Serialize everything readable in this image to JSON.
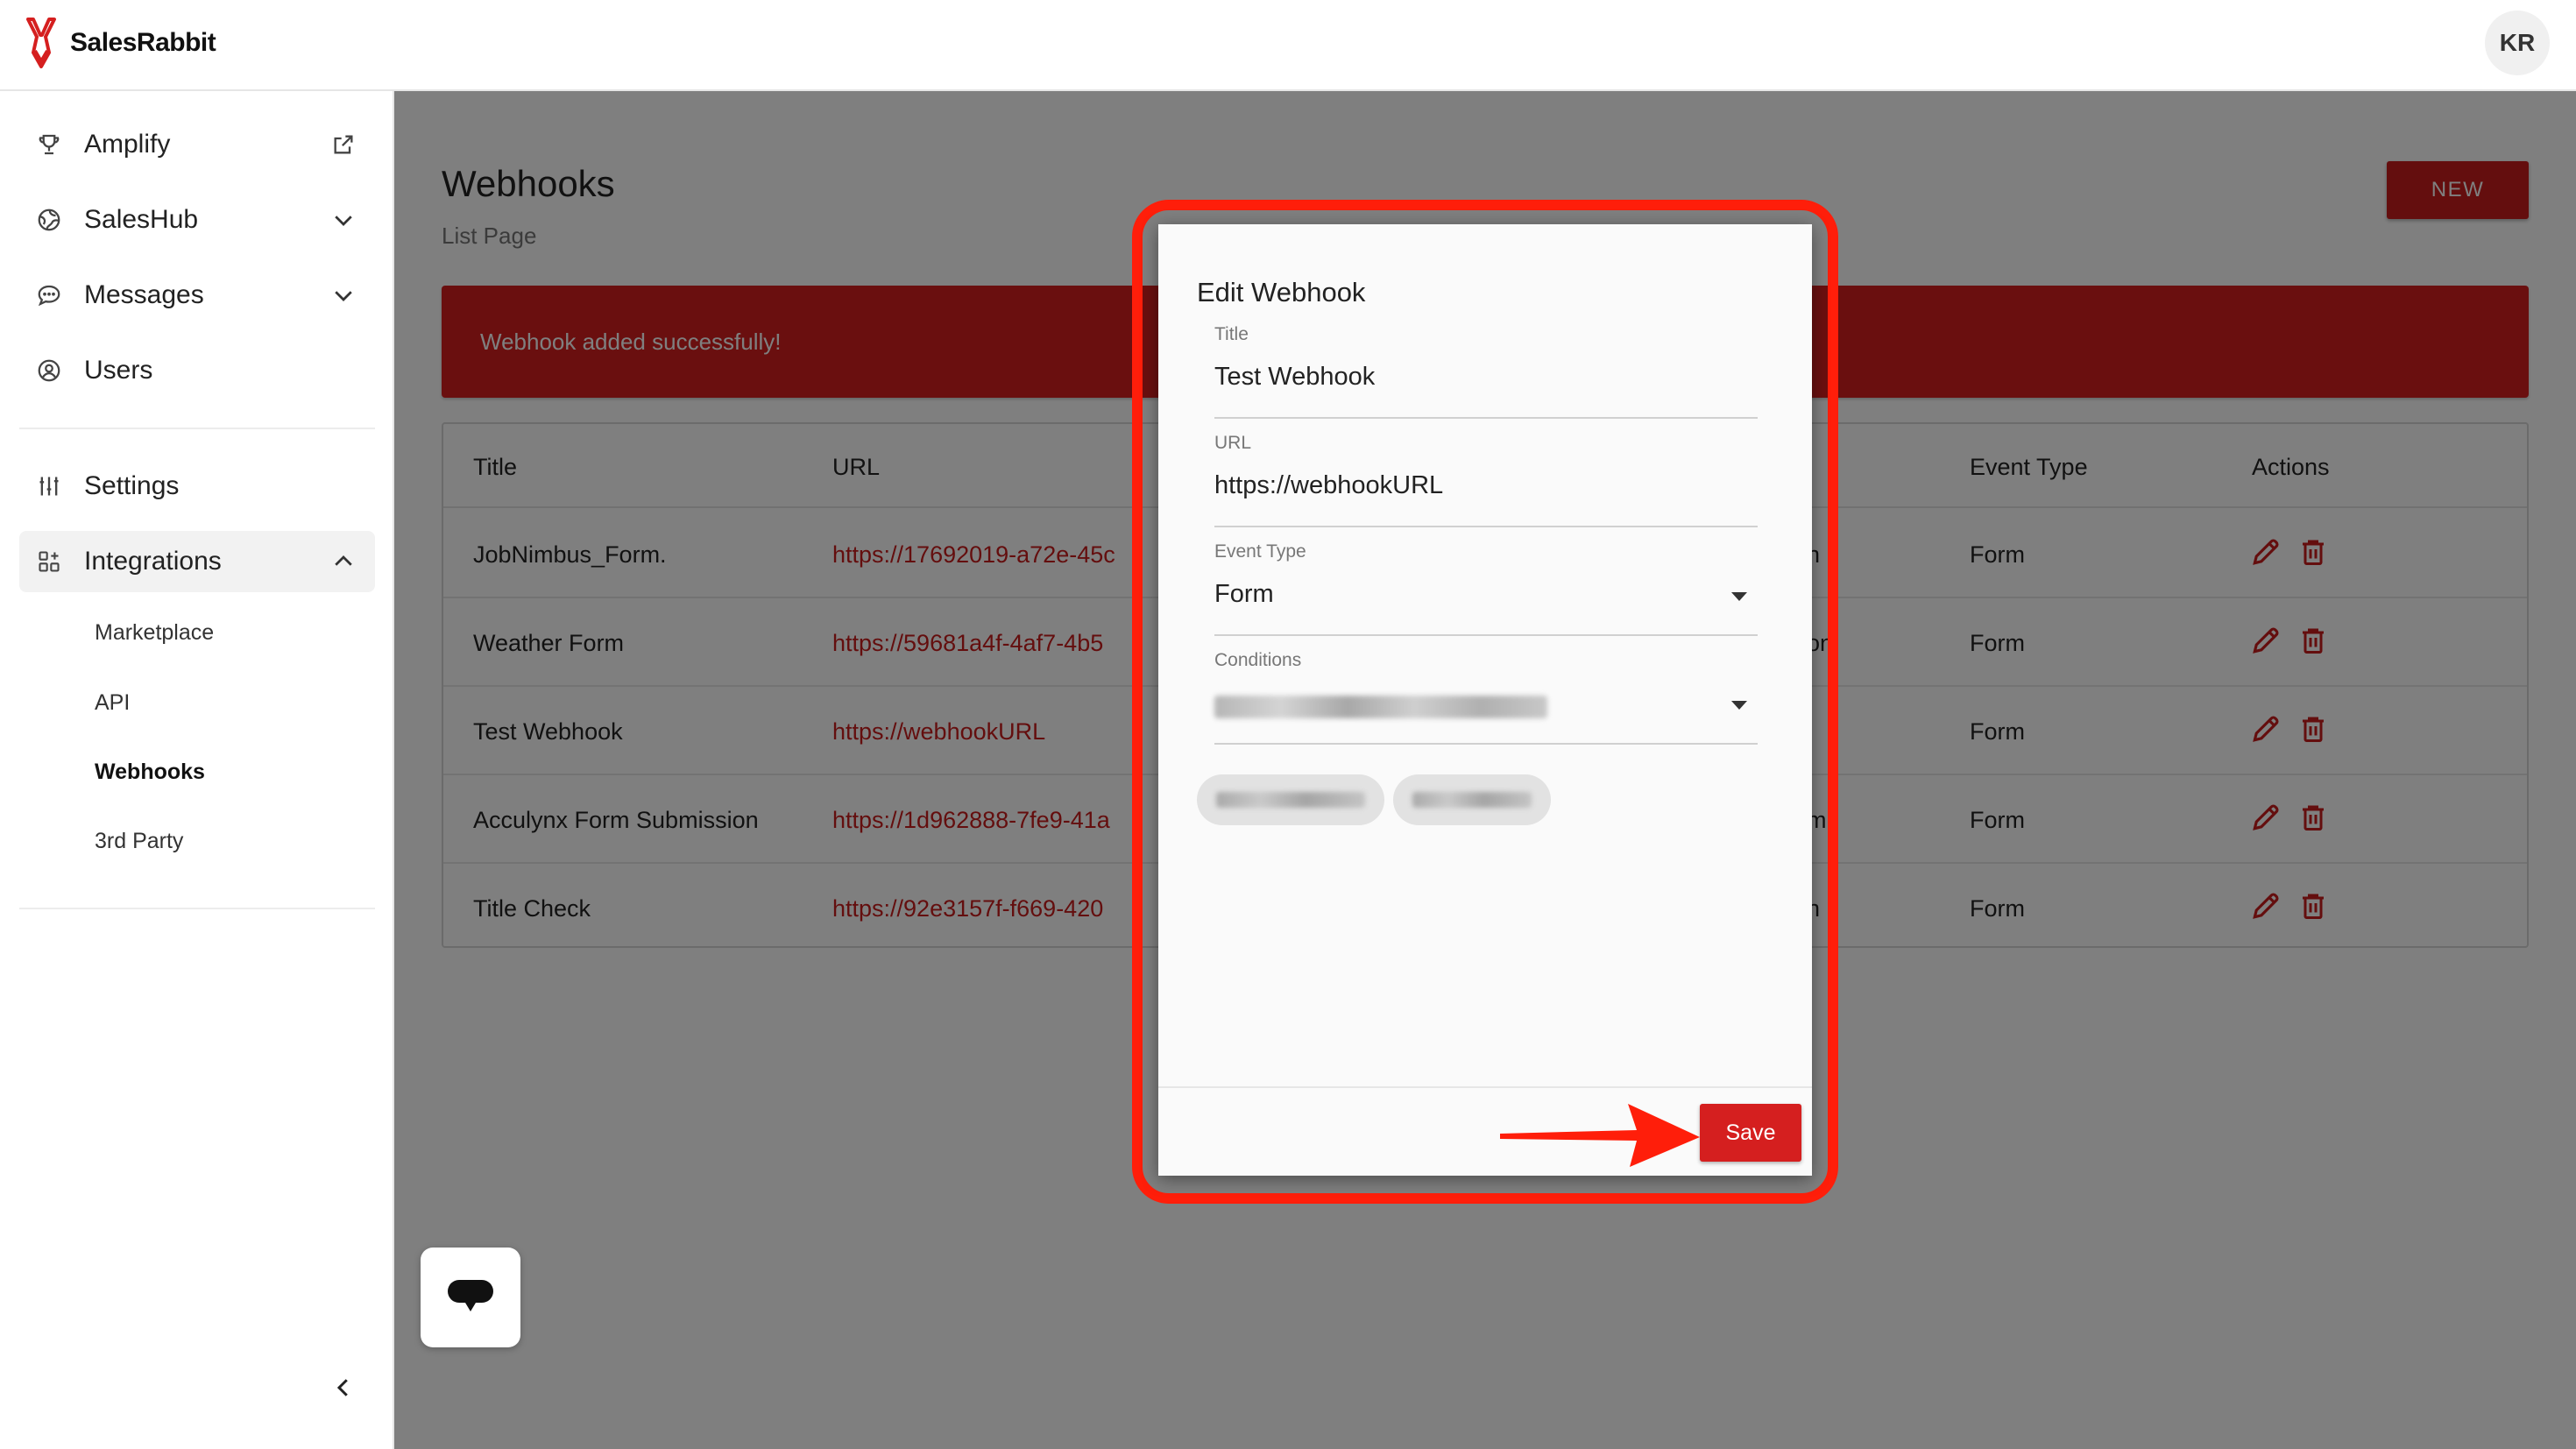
{
  "app": {
    "name": "SalesRabbit",
    "user_initials": "KR"
  },
  "sidebar": {
    "items": [
      {
        "label": "Amplify",
        "icon": "trophy-icon",
        "trail": "external-link-icon"
      },
      {
        "label": "SalesHub",
        "icon": "globe-icon",
        "trail": "chevron-down-icon"
      },
      {
        "label": "Messages",
        "icon": "chat-bubble-icon",
        "trail": "chevron-down-icon"
      },
      {
        "label": "Users",
        "icon": "user-circle-icon",
        "trail": ""
      },
      {
        "label": "Settings",
        "icon": "sliders-icon",
        "trail": ""
      },
      {
        "label": "Integrations",
        "icon": "grid-icon",
        "trail": "chevron-up-icon"
      }
    ],
    "sub_items": [
      "Marketplace",
      "API",
      "Webhooks",
      "3rd Party"
    ],
    "current_sub": "Webhooks"
  },
  "page": {
    "title": "Webhooks",
    "subtitle": "List Page",
    "new_label": "NEW",
    "alert": "Webhook added successfully!"
  },
  "table": {
    "columns": [
      "Title",
      "URL",
      "Event Type",
      "Actions"
    ],
    "rows": [
      {
        "title": "JobNimbus_Form.",
        "url": "https://17692019-a72e-45c",
        "tail": "n",
        "event_type": "Form"
      },
      {
        "title": "Weather Form",
        "url": "https://59681a4f-4af7-4b5",
        "tail": "on",
        "event_type": "Form"
      },
      {
        "title": "Test Webhook",
        "url": "https://webhookURL",
        "tail": "",
        "event_type": "Form"
      },
      {
        "title": "Acculynx Form Submission",
        "url": "https://1d962888-7fe9-41a",
        "tail": "m",
        "event_type": "Form"
      },
      {
        "title": "Title Check",
        "url": "https://92e3157f-f669-420",
        "tail": "n",
        "event_type": "Form"
      }
    ]
  },
  "modal": {
    "title": "Edit Webhook",
    "fields": {
      "title_label": "Title",
      "title_value": "Test Webhook",
      "url_label": "URL",
      "url_value": "https://webhookURL",
      "event_label": "Event Type",
      "event_value": "Form",
      "conditions_label": "Conditions"
    },
    "save_label": "Save"
  },
  "colors": {
    "brand": "#c81d1d",
    "highlight": "#ff1e0a",
    "alert": "#d51f1f"
  }
}
